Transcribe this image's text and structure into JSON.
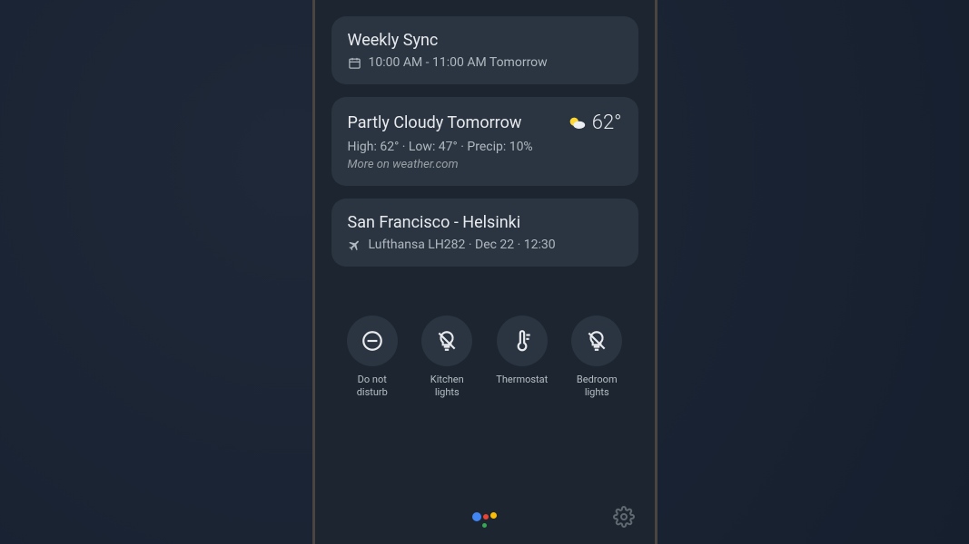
{
  "calendar_card": {
    "title": "Weekly Sync",
    "time": "10:00 AM - 11:00 AM Tomorrow"
  },
  "weather_card": {
    "title": "Partly Cloudy Tomorrow",
    "temp": "62°",
    "detail": "High: 62° · Low: 47° · Precip: 10%",
    "more": "More on weather.com"
  },
  "flight_card": {
    "title": "San Francisco - Helsinki",
    "detail": "Lufthansa LH282  ·  Dec 22  ·  12:30"
  },
  "controls": {
    "dnd": "Do not\ndisturb",
    "kitchen": "Kitchen\nlights",
    "thermostat": "Thermostat",
    "bedroom": "Bedroom\nlights"
  },
  "colors": {
    "blue": "#4285F4",
    "red": "#EA4335",
    "yellow": "#FBBC05",
    "green": "#34A853"
  }
}
